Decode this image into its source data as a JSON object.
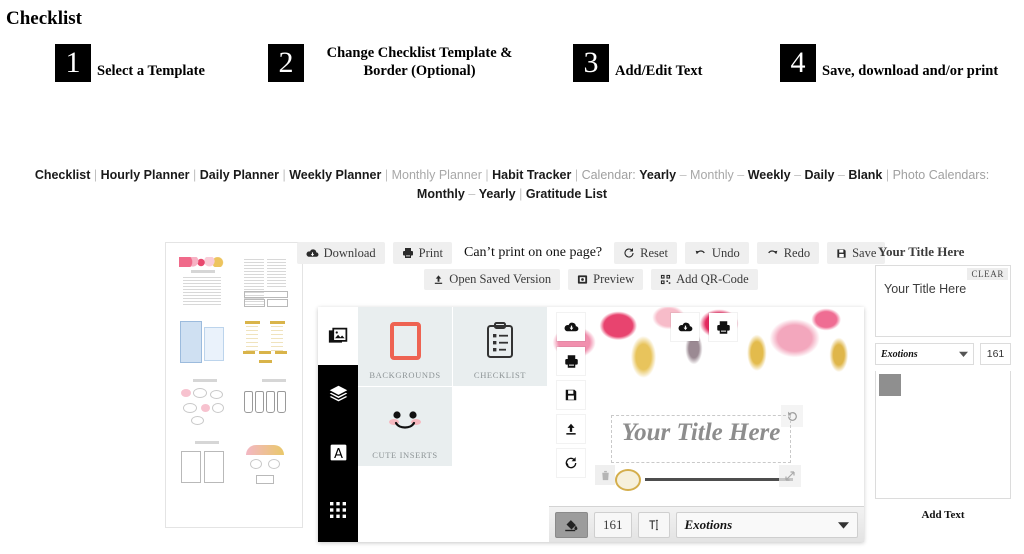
{
  "page": {
    "title": "Checklist"
  },
  "steps": [
    {
      "num": "1",
      "label": "Select a Template"
    },
    {
      "num": "2",
      "label": "Change Checklist Template & Border (Optional)"
    },
    {
      "num": "3",
      "label": "Add/Edit Text"
    },
    {
      "num": "4",
      "label": "Save, download and/or print"
    }
  ],
  "nav": {
    "items": [
      {
        "text": "Checklist",
        "style": "active"
      },
      {
        "text": "|",
        "style": "sep"
      },
      {
        "text": "Hourly Planner",
        "style": "active"
      },
      {
        "text": "|",
        "style": "sep"
      },
      {
        "text": "Daily Planner",
        "style": "active"
      },
      {
        "text": "|",
        "style": "sep"
      },
      {
        "text": "Weekly Planner",
        "style": "active"
      },
      {
        "text": "|",
        "style": "sep"
      },
      {
        "text": "Monthly Planner",
        "style": "muted"
      },
      {
        "text": "|",
        "style": "sep"
      },
      {
        "text": "Habit Tracker",
        "style": "active"
      },
      {
        "text": "|",
        "style": "sep"
      },
      {
        "text": "Calendar:",
        "style": "label"
      },
      {
        "text": "Yearly",
        "style": "active"
      },
      {
        "text": "–",
        "style": "sep"
      },
      {
        "text": "Monthly",
        "style": "muted"
      },
      {
        "text": "–",
        "style": "sep"
      },
      {
        "text": "Weekly",
        "style": "active"
      },
      {
        "text": "–",
        "style": "sep"
      },
      {
        "text": "Daily",
        "style": "active"
      },
      {
        "text": "–",
        "style": "sep"
      },
      {
        "text": "Blank",
        "style": "active"
      },
      {
        "text": "|",
        "style": "sep"
      },
      {
        "text": "Photo Calendars:",
        "style": "label"
      },
      {
        "text": "Monthly",
        "style": "active"
      },
      {
        "text": "–",
        "style": "sep"
      },
      {
        "text": "Yearly",
        "style": "active"
      },
      {
        "text": "|",
        "style": "sep"
      },
      {
        "text": "Gratitude List",
        "style": "active"
      }
    ]
  },
  "toolbar": {
    "row1": [
      {
        "label": "Download",
        "icon": "cloud-download-icon",
        "type": "button"
      },
      {
        "label": "Print",
        "icon": "printer-icon",
        "type": "button"
      },
      {
        "label": "Can’t print on one page?",
        "icon": "",
        "type": "note"
      },
      {
        "label": "Reset",
        "icon": "refresh-icon",
        "type": "button"
      },
      {
        "label": "Undo",
        "icon": "undo-icon",
        "type": "button"
      },
      {
        "label": "Redo",
        "icon": "redo-icon",
        "type": "button"
      },
      {
        "label": "Save",
        "icon": "save-icon",
        "type": "button"
      }
    ],
    "row2": [
      {
        "label": "Open Saved Version",
        "icon": "upload-icon",
        "type": "button"
      },
      {
        "label": "Preview",
        "icon": "preview-icon",
        "type": "button"
      },
      {
        "label": "Add QR-Code",
        "icon": "qr-icon",
        "type": "button"
      }
    ]
  },
  "editor": {
    "vnav": [
      {
        "name": "images",
        "icon": "images-icon",
        "active": true
      },
      {
        "name": "layers",
        "icon": "layers-icon",
        "active": false
      },
      {
        "name": "text",
        "icon": "text-a-icon",
        "active": false
      },
      {
        "name": "grid",
        "icon": "grid-icon",
        "active": false
      }
    ],
    "categories": [
      {
        "label": "BACKGROUNDS",
        "icon": "frame-icon"
      },
      {
        "label": "CHECKLIST",
        "icon": "clipboard-icon"
      },
      {
        "label": "CUTE INSERTS",
        "icon": "smiley-icon"
      }
    ],
    "canvas": {
      "title_text": "Your Title Here",
      "float_buttons": [
        {
          "name": "cloud-download",
          "icon": "cloud-download-icon"
        },
        {
          "name": "print",
          "icon": "printer-icon"
        },
        {
          "name": "save",
          "icon": "save-icon"
        },
        {
          "name": "upload",
          "icon": "upload-icon"
        },
        {
          "name": "refresh",
          "icon": "refresh-icon"
        }
      ],
      "overlay_buttons": [
        {
          "name": "cloud-download",
          "icon": "cloud-download-icon"
        },
        {
          "name": "print",
          "icon": "printer-icon"
        }
      ]
    },
    "bottom_toolbar": {
      "fill_icon": "paint-bucket-icon",
      "font_size": "161",
      "text_icon": "text-cursor-icon",
      "font_name": "Exotions"
    }
  },
  "right_panel": {
    "header": "Your Title Here",
    "clear_label": "CLEAR",
    "text_value": "Your Title Here",
    "font_name": "Exotions",
    "font_size": "161",
    "swatch_color": "#8f8f8f",
    "add_text_label": "Add Text"
  }
}
